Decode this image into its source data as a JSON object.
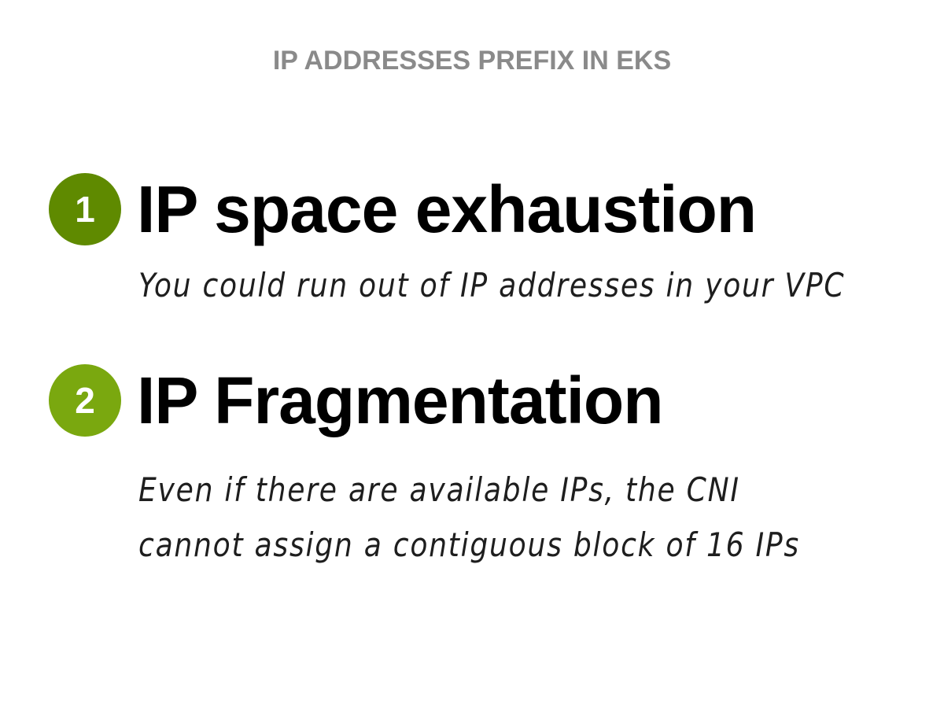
{
  "slide": {
    "kicker": "IP ADDRESSES PREFIX IN EKS",
    "points": [
      {
        "number": "1",
        "badge_color": "#5f8a00",
        "heading": "IP space exhaustion",
        "note_lines": [
          "You could run out of IP addresses in your VPC"
        ]
      },
      {
        "number": "2",
        "badge_color": "#7aa80f",
        "heading": "IP Fragmentation",
        "note_lines": [
          "Even if there are available IPs, the CNI",
          "cannot assign a contiguous block of 16 IPs"
        ]
      }
    ]
  }
}
